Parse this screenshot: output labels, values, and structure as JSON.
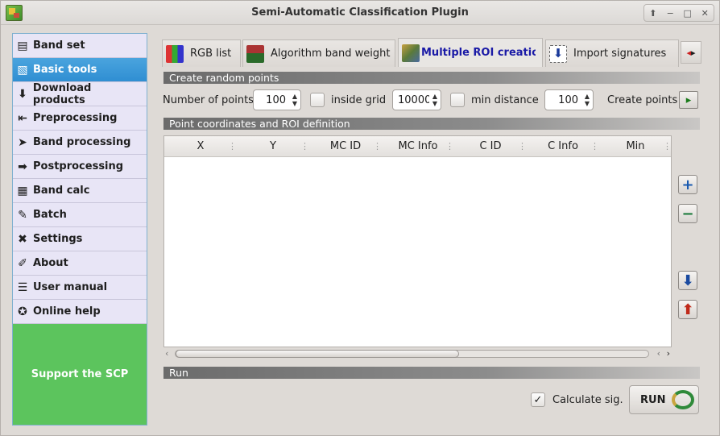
{
  "window": {
    "title": "Semi-Automatic Classification Plugin",
    "controls": [
      "⬆",
      "−",
      "□",
      "✕"
    ]
  },
  "sidebar": {
    "items": [
      {
        "label": "Band set",
        "icon": "band-set-icon",
        "glyph": "▤"
      },
      {
        "label": "Basic tools",
        "icon": "basic-tools-icon",
        "glyph": "▧",
        "active": true
      },
      {
        "label": "Download products",
        "icon": "download-icon",
        "glyph": "⬇"
      },
      {
        "label": "Preprocessing",
        "icon": "preprocessing-icon",
        "glyph": "⇤"
      },
      {
        "label": "Band processing",
        "icon": "band-processing-icon",
        "glyph": "➤"
      },
      {
        "label": "Postprocessing",
        "icon": "postprocessing-icon",
        "glyph": "➡"
      },
      {
        "label": "Band calc",
        "icon": "band-calc-icon",
        "glyph": "▦"
      },
      {
        "label": "Batch",
        "icon": "batch-icon",
        "glyph": "✎"
      },
      {
        "label": "Settings",
        "icon": "settings-icon",
        "glyph": "✖"
      },
      {
        "label": "About",
        "icon": "about-icon",
        "glyph": "✐"
      },
      {
        "label": "User manual",
        "icon": "user-manual-icon",
        "glyph": "☰"
      },
      {
        "label": "Online help",
        "icon": "online-help-icon",
        "glyph": "✪"
      }
    ],
    "support_label": "Support the SCP"
  },
  "tabs": [
    {
      "label": "RGB list",
      "icon": "rgb-list-icon"
    },
    {
      "label": "Algorithm band weight",
      "icon": "algorithm-band-weight-icon"
    },
    {
      "label": "Multiple ROI creation",
      "icon": "multiple-roi-icon",
      "active": true
    },
    {
      "label": "Import signatures",
      "icon": "import-signatures-icon"
    }
  ],
  "sections": {
    "random_points": "Create random points",
    "point_coords": "Point coordinates and ROI definition",
    "run": "Run"
  },
  "random_points": {
    "number_label": "Number of points",
    "number_value": "100",
    "inside_grid_label": "inside grid",
    "grid_value": "10000",
    "min_distance_label": "min distance",
    "min_distance_value": "100",
    "create_points_label": "Create points"
  },
  "table": {
    "columns": [
      "X",
      "Y",
      "MC ID",
      "MC Info",
      "C ID",
      "C Info",
      "Min"
    ]
  },
  "run": {
    "calc_sig_label": "Calculate sig.",
    "calc_sig_checked": true,
    "run_label": "RUN"
  },
  "colors": {
    "accent": "#2f8ed2",
    "support": "#5cc45d",
    "active_tab_text": "#1a1aa6"
  }
}
